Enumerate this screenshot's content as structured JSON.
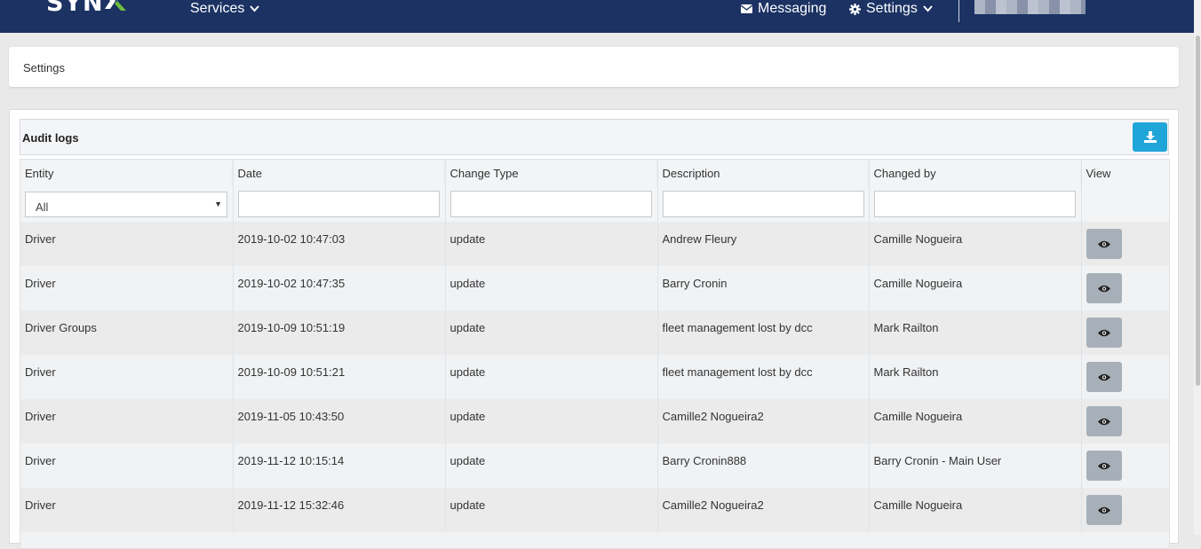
{
  "topbar": {
    "logo_text": "SYN",
    "services_label": "Services",
    "messaging_label": "Messaging",
    "settings_label": "Settings",
    "brand_color": "#1b3263"
  },
  "breadcrumb": {
    "label": "Settings"
  },
  "audit": {
    "title": "Audit logs",
    "download_icon": "download-icon",
    "columns": [
      "Entity",
      "Date",
      "Change Type",
      "Description",
      "Changed by",
      "View"
    ],
    "entity_filter_value": "All",
    "rows": [
      {
        "entity": "Driver",
        "date": "2019-10-02 10:47:03",
        "change_type": "update",
        "description": "Andrew Fleury",
        "changed_by": "Camille Nogueira"
      },
      {
        "entity": "Driver",
        "date": "2019-10-02 10:47:35",
        "change_type": "update",
        "description": "Barry Cronin",
        "changed_by": "Camille Nogueira"
      },
      {
        "entity": "Driver Groups",
        "date": "2019-10-09 10:51:19",
        "change_type": "update",
        "description": "fleet management lost by dcc",
        "changed_by": "Mark Railton"
      },
      {
        "entity": "Driver",
        "date": "2019-10-09 10:51:21",
        "change_type": "update",
        "description": "fleet management lost by dcc",
        "changed_by": "Mark Railton"
      },
      {
        "entity": "Driver",
        "date": "2019-11-05 10:43:50",
        "change_type": "update",
        "description": "Camille2 Nogueira2",
        "changed_by": "Camille Nogueira"
      },
      {
        "entity": "Driver",
        "date": "2019-11-12 10:15:14",
        "change_type": "update",
        "description": "Barry Cronin888",
        "changed_by": "Barry Cronin - Main User"
      },
      {
        "entity": "Driver",
        "date": "2019-11-12 15:32:46",
        "change_type": "update",
        "description": "Camille2 Nogueira2",
        "changed_by": "Camille Nogueira"
      }
    ],
    "accent_color": "#1fa5d8"
  }
}
